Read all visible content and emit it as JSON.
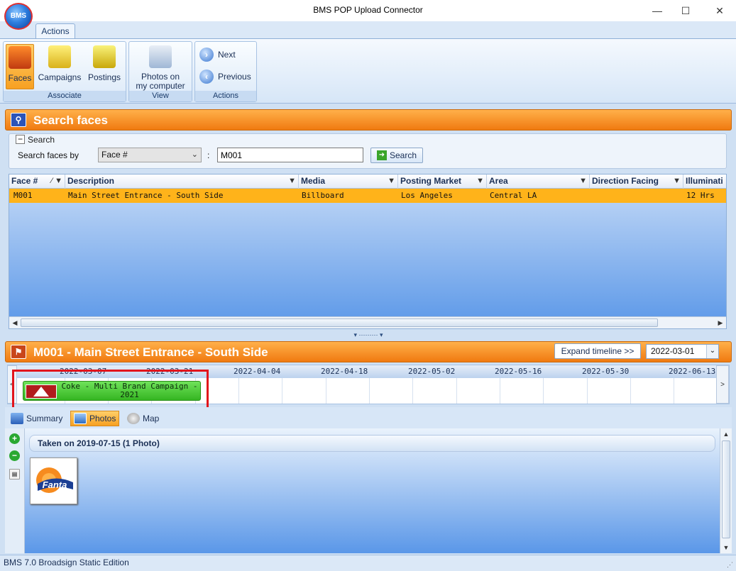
{
  "window": {
    "title": "BMS POP Upload Connector",
    "logo_text": "BMS",
    "minimize": "—",
    "maximize": "☐",
    "close": "✕"
  },
  "ribbon": {
    "tab": "Actions",
    "groups": {
      "associate": {
        "label": "Associate",
        "faces": "Faces",
        "campaigns": "Campaigns",
        "postings": "Postings"
      },
      "view": {
        "label": "View",
        "photos_line1": "Photos on",
        "photos_line2": "my computer"
      },
      "actions": {
        "label": "Actions",
        "next": "Next",
        "previous": "Previous"
      }
    }
  },
  "search_panel": {
    "title": "Search faces",
    "legend": "Search",
    "search_by_label": "Search faces by",
    "search_by_value": "Face #",
    "colon": ":",
    "query": "M001",
    "search_button": "Search"
  },
  "grid": {
    "columns": [
      "Face #",
      "Description",
      "Media",
      "Posting Market",
      "Area",
      "Direction Facing",
      "Illuminati"
    ],
    "rows": [
      {
        "face": "M001",
        "description": "Main Street Entrance - South Side",
        "media": "Billboard",
        "market": "Los Angeles",
        "area": "Central LA",
        "direction": "",
        "illumination": "12 Hrs"
      }
    ]
  },
  "splitter": "▾ ⋯⋯⋯ ▾",
  "detail": {
    "title": "M001 - Main Street Entrance - South Side",
    "expand_timeline": "Expand timeline >>",
    "timeline_date": "2022-03-01"
  },
  "timeline": {
    "dates": [
      "2022-03-07",
      "2022-03-21",
      "2022-04-04",
      "2022-04-18",
      "2022-05-02",
      "2022-05-16",
      "2022-05-30",
      "2022-06-13"
    ],
    "campaign_line1": "Coke - Multi Brand Campaign -",
    "campaign_line2": "2021",
    "left_arrow": "<",
    "right_arrow": ">"
  },
  "tabs": {
    "summary": "Summary",
    "photos": "Photos",
    "map": "Map"
  },
  "photos": {
    "group_title": "Taken on 2019-07-15  (1 Photo)",
    "photo_label": "Fanta"
  },
  "status": "BMS 7.0 Broadsign Static Edition",
  "colors": {
    "accent_orange": "#f07a10",
    "selected_row": "#ffb31a",
    "campaign_green": "#35b522",
    "highlight_red": "#e2141c"
  }
}
